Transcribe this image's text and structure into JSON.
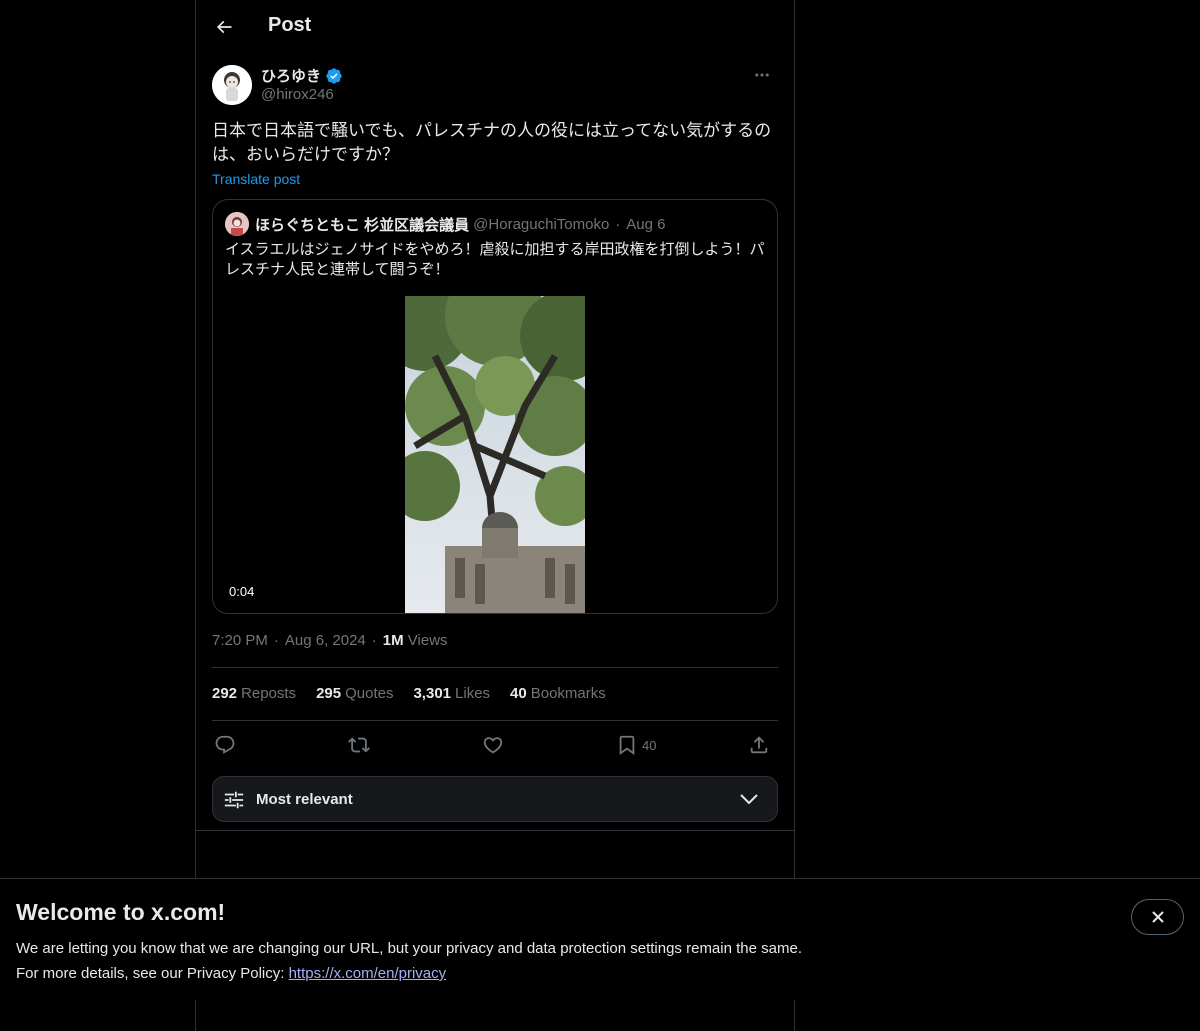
{
  "header": {
    "title": "Post"
  },
  "author": {
    "name": "ひろゆき",
    "handle": "@hirox246",
    "verified": true
  },
  "post": {
    "text": "日本で日本語で騒いでも、パレスチナの人の役には立ってない気がするのは、おいらだけですか？",
    "translate_label": "Translate post",
    "time": "7:20 PM",
    "date": "Aug 6, 2024",
    "views_count": "1M",
    "views_label": "Views"
  },
  "quote": {
    "name": "ほらぐちともこ 杉並区議会議員",
    "handle": "@HoraguchiTomoko",
    "separator": "·",
    "date": "Aug 6",
    "text": "イスラエルはジェノサイドをやめろ！虐殺に加担する岸田政権を打倒しよう！パレスチナ人民と連帯して闘うぞ！",
    "video_duration": "0:04"
  },
  "stats": [
    {
      "count": "292",
      "label": "Reposts"
    },
    {
      "count": "295",
      "label": "Quotes"
    },
    {
      "count": "3,301",
      "label": "Likes"
    },
    {
      "count": "40",
      "label": "Bookmarks"
    }
  ],
  "actions": {
    "bookmark_count": "40",
    "icons": [
      "reply-icon",
      "repost-icon",
      "like-icon",
      "bookmark-icon",
      "share-icon"
    ]
  },
  "sort": {
    "label": "Most relevant"
  },
  "banner": {
    "title": "Welcome to x.com!",
    "line1": "We are letting you know that we are changing our URL, but your privacy and data protection settings remain the same.",
    "line2_prefix": "For more details, see our Privacy Policy: ",
    "link": "https://x.com/en/privacy"
  },
  "colors": {
    "accent": "#1d9bf0",
    "background": "#000000",
    "muted": "#71767b",
    "border": "#2f3336"
  }
}
